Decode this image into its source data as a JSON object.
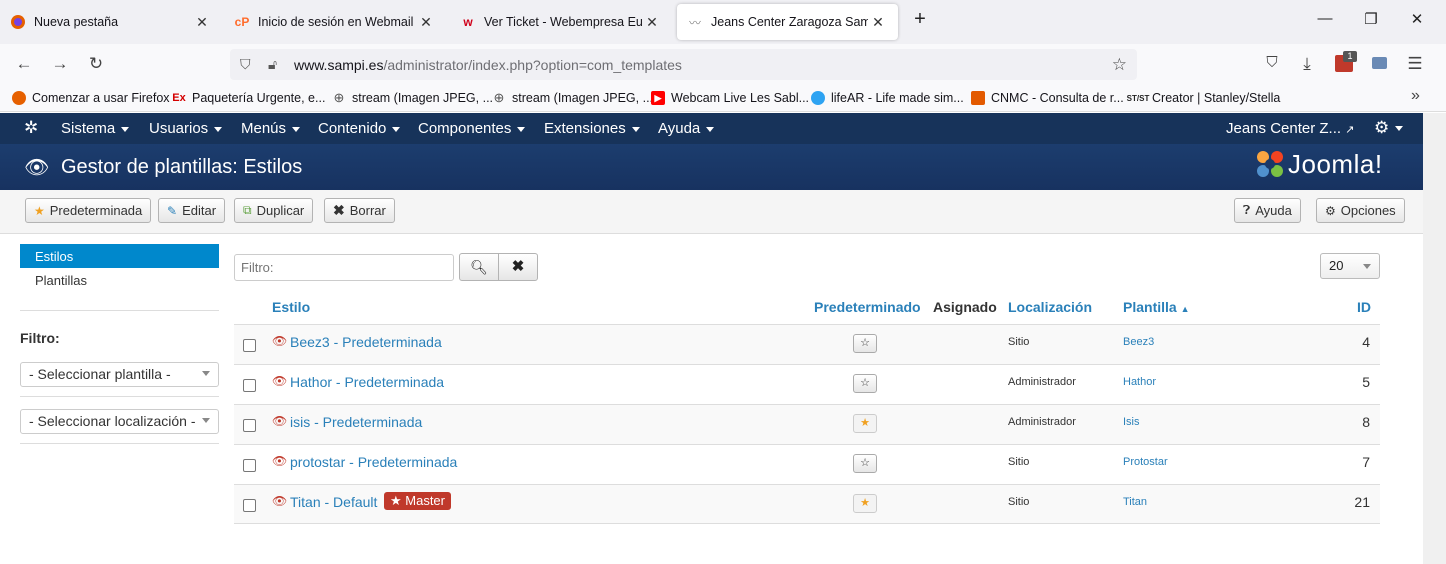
{
  "browser": {
    "tabs": [
      {
        "title": "Nueva pestaña",
        "icon": "firefox-icon"
      },
      {
        "title": "Inicio de sesión en Webmail",
        "icon": "cpanel-icon"
      },
      {
        "title": "Ver Ticket - Webempresa Europ",
        "icon": "webempresa-icon"
      },
      {
        "title": "Jeans Center Zaragoza Sampi - A",
        "icon": "site-icon"
      }
    ],
    "url_host": "www.sampi.es",
    "url_path": "/administrator/index.php?option=com_templates",
    "extension_badge": "1",
    "bookmarks": [
      {
        "label": "Comenzar a usar Firefox",
        "icon": "firefox-icon",
        "color": "#e66000"
      },
      {
        "label": "Paquetería Urgente, e...",
        "icon": "ex-icon",
        "color": "#d40000"
      },
      {
        "label": "stream (Imagen JPEG, ...",
        "icon": "globe-icon",
        "color": "#555555"
      },
      {
        "label": "stream (Imagen JPEG, ...",
        "icon": "globe-icon",
        "color": "#555555"
      },
      {
        "label": "Webcam Live Les Sabl...",
        "icon": "youtube-icon",
        "color": "#ff0000"
      },
      {
        "label": "lifeAR - Life made sim...",
        "icon": "lifear-icon",
        "color": "#2ea3f2"
      },
      {
        "label": "CNMC - Consulta de r...",
        "icon": "cnmc-icon",
        "color": "#e35a00"
      },
      {
        "label": "Creator | Stanley/Stella",
        "icon": "stanley-icon",
        "color": "#222222"
      }
    ]
  },
  "joomla": {
    "menu": [
      "Sistema",
      "Usuarios",
      "Menús",
      "Contenido",
      "Componentes",
      "Extensiones",
      "Ayuda"
    ],
    "site_name": "Jeans Center Z...",
    "page_title": "Gestor de plantillas: Estilos",
    "brand": "Joomla!",
    "toolbar": {
      "default": "Predeterminada",
      "edit": "Editar",
      "duplicate": "Duplicar",
      "delete": "Borrar",
      "help": "Ayuda",
      "options": "Opciones"
    },
    "sidebar": {
      "items": [
        "Estilos",
        "Plantillas"
      ],
      "filter_label": "Filtro:",
      "select_template": "- Seleccionar plantilla -",
      "select_location": "- Seleccionar localización -"
    },
    "search_placeholder": "Filtro:",
    "limit": "20",
    "columns": {
      "style": "Estilo",
      "default": "Predeterminado",
      "assigned": "Asignado",
      "location": "Localización",
      "template": "Plantilla",
      "id": "ID"
    },
    "rows": [
      {
        "name": "Beez3 - Predeterminada",
        "default": false,
        "location": "Sitio",
        "template": "Beez3",
        "id": "4"
      },
      {
        "name": "Hathor - Predeterminada",
        "default": false,
        "location": "Administrador",
        "template": "Hathor",
        "id": "5"
      },
      {
        "name": "isis - Predeterminada",
        "default": true,
        "location": "Administrador",
        "template": "Isis",
        "id": "8"
      },
      {
        "name": "protostar - Predeterminada",
        "default": false,
        "location": "Sitio",
        "template": "Protostar",
        "id": "7"
      },
      {
        "name": "Titan - Default",
        "badge": "★ Master",
        "default": true,
        "location": "Sitio",
        "template": "Titan",
        "id": "21"
      }
    ]
  }
}
